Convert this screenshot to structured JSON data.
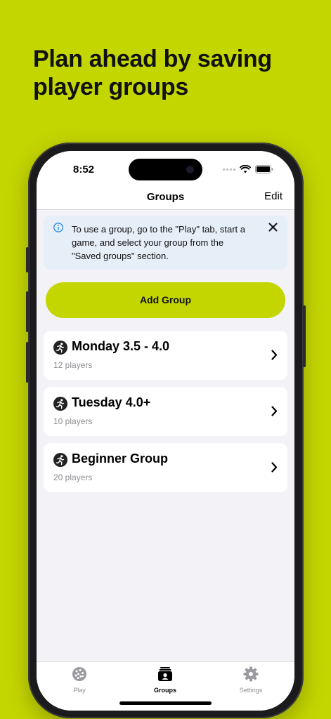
{
  "headline": "Plan ahead by saving player groups",
  "status": {
    "time": "8:52"
  },
  "nav": {
    "title": "Groups",
    "edit_label": "Edit"
  },
  "info_banner": {
    "text": "To use a group, go to the \"Play\" tab, start a game, and select your group from the \"Saved groups\" section.",
    "icon": "info-icon",
    "close_icon": "close-icon"
  },
  "add_group_label": "Add Group",
  "groups": [
    {
      "name": "Monday 3.5 - 4.0",
      "players": "12 players"
    },
    {
      "name": "Tuesday 4.0+",
      "players": "10 players"
    },
    {
      "name": "Beginner Group",
      "players": "20 players"
    }
  ],
  "tabs": [
    {
      "label": "Play",
      "icon": "pickleball-icon",
      "active": false
    },
    {
      "label": "Groups",
      "icon": "groups-icon",
      "active": true
    },
    {
      "label": "Settings",
      "icon": "gear-icon",
      "active": false
    }
  ],
  "colors": {
    "accent": "#c4d600",
    "banner": "#e6eef8",
    "info": "#2b86e6"
  }
}
